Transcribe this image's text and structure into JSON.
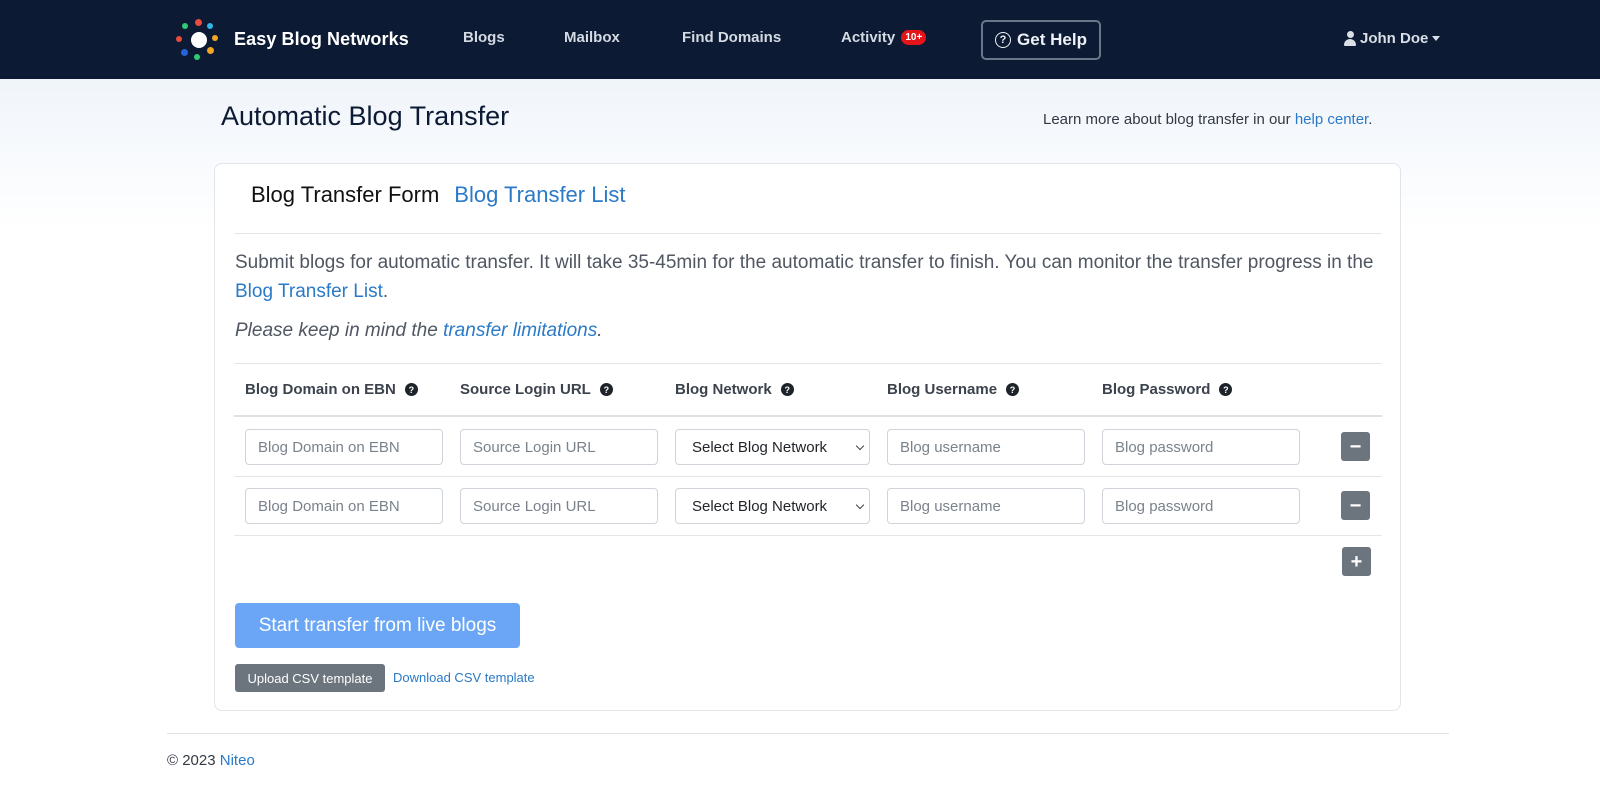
{
  "navbar": {
    "brand": "Easy Blog Networks",
    "links": {
      "blogs": "Blogs",
      "mailbox": "Mailbox",
      "find_domains": "Find Domains",
      "activity": "Activity",
      "activity_badge": "10+"
    },
    "help": "Get Help",
    "user": "John Doe"
  },
  "header": {
    "title": "Automatic Blog Transfer",
    "learn_prefix": "Learn more about blog transfer in our ",
    "learn_link": "help center",
    "learn_suffix": "."
  },
  "card": {
    "tabs": {
      "active": "Blog Transfer Form",
      "other": "Blog Transfer List"
    },
    "description_prefix": "Submit blogs for automatic transfer. It will take 35-45min for the automatic transfer to finish. You can monitor the transfer progress in the ",
    "description_link": "Blog Transfer List",
    "description_suffix": ".",
    "note_prefix": "Please keep in mind the ",
    "note_link": "transfer limitations",
    "note_suffix": ".",
    "columns": {
      "domain": "Blog Domain on EBN",
      "login_url": "Source Login URL",
      "network": "Blog Network",
      "username": "Blog Username",
      "password": "Blog Password"
    },
    "placeholders": {
      "domain": "Blog Domain on EBN",
      "login_url": "Source Login URL",
      "username": "Blog username",
      "password": "Blog password"
    },
    "network_select": "Select Blog Network",
    "remove_symbol": "−",
    "add_symbol": "+",
    "start_button": "Start transfer from live blogs",
    "upload_button": "Upload CSV template",
    "download_link": "Download CSV template"
  },
  "footer": {
    "copyright": "© 2023 ",
    "company": "Niteo"
  },
  "colors": {
    "navbar": "#0c1a33",
    "link": "#2a7ac7",
    "primary_button": "#6aa6f5",
    "secondary_button": "#6c757d",
    "badge": "#e3151a"
  }
}
